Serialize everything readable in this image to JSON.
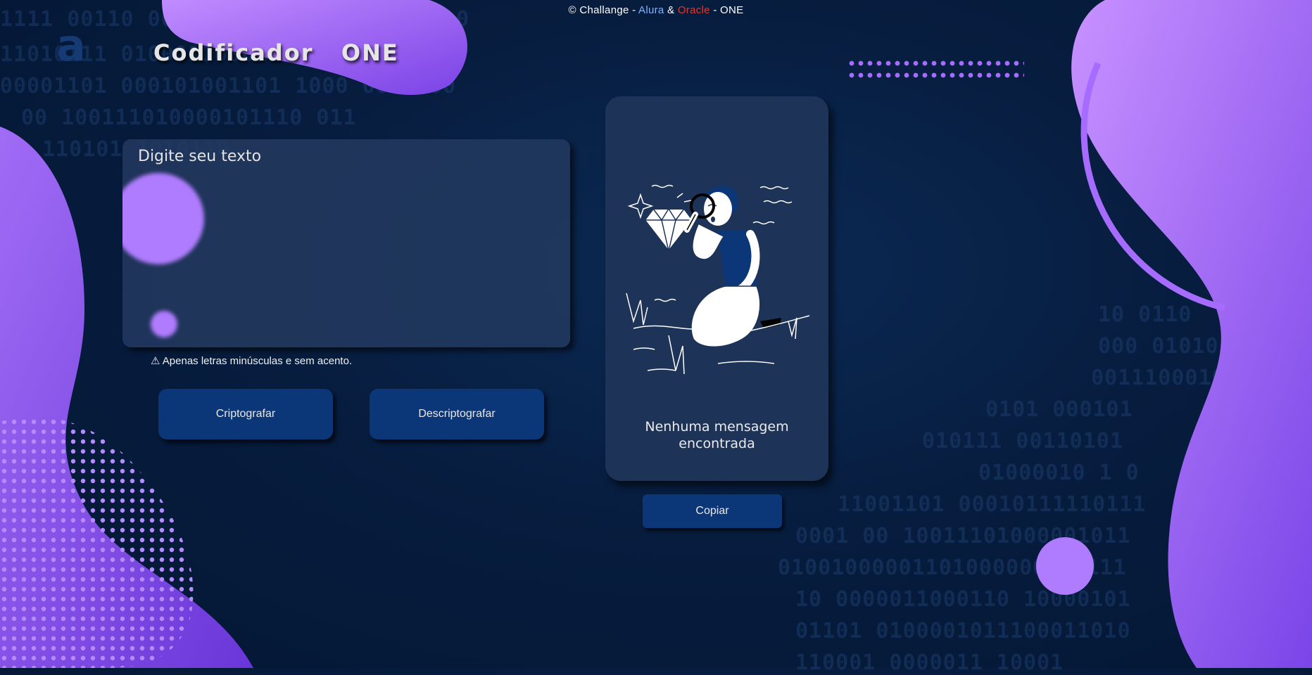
{
  "footer": {
    "copyright": "© Challange - ",
    "alura": "Alura",
    "amp": " & ",
    "oracle": "Oracle",
    "tail": " - ONE"
  },
  "header": {
    "logo_glyph": "a",
    "title": "Codificador   ONE"
  },
  "input": {
    "placeholder": "Digite seu texto"
  },
  "hint": {
    "text": "⚠ Apenas letras minúsculas e sem acento."
  },
  "buttons": {
    "encrypt": "Criptografar",
    "decrypt": "Descriptografar",
    "copy": "Copiar"
  },
  "result": {
    "line1": "Nenhuma mensagem",
    "line2": "encontrada"
  },
  "colors": {
    "background": "#071d3f",
    "accent_purple": "#a66cff",
    "button": "#0b3779",
    "card": "#1e3358"
  },
  "icons": {
    "illustration": "person-magnifying-glass-diamond-illustration"
  }
}
